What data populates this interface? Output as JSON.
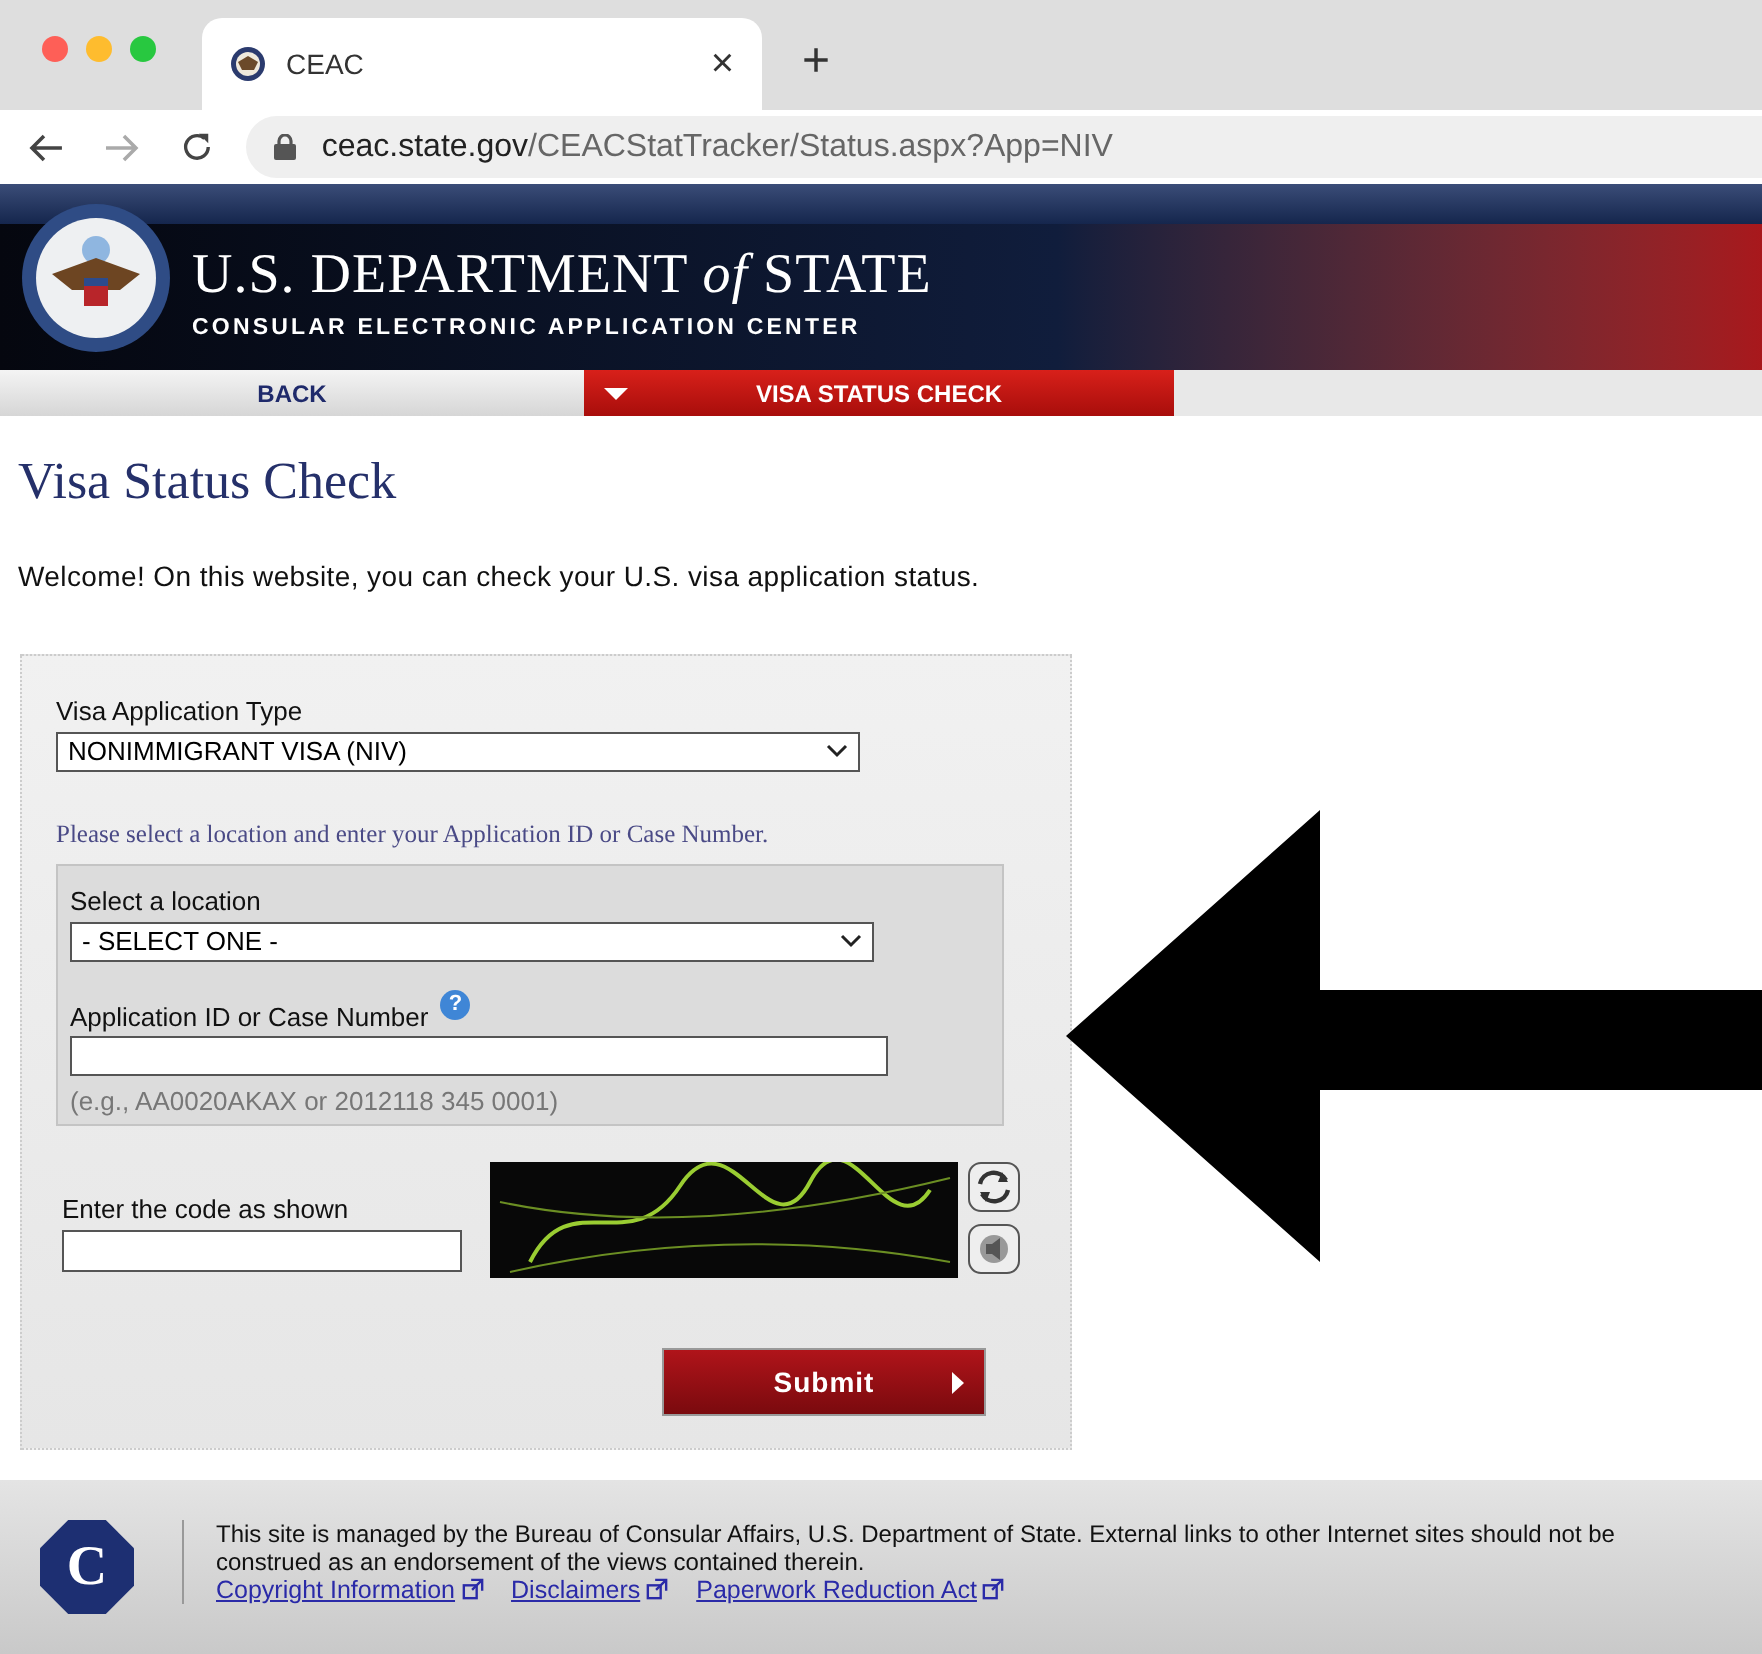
{
  "browser": {
    "tab_title": "CEAC",
    "tab_close": "×",
    "new_tab": "+",
    "url_host": "ceac.state.gov",
    "url_path": "/CEACStatTracker/Status.aspx?App=NIV"
  },
  "banner": {
    "title": "U.S. DEPARTMENT *of* STATE",
    "subtitle": "CONSULAR ELECTRONIC APPLICATION CENTER"
  },
  "nav": [
    {
      "label": "BACK",
      "selected": false
    },
    {
      "label": "VISA STATUS CHECK",
      "selected": true
    }
  ],
  "page_title": "Visa Status Check",
  "welcome": "Welcome! On this website, you can check your U.S. visa application status.",
  "form": {
    "type_label": "Visa Application Type",
    "type_value": "NONIMMIGRANT VISA (NIV)",
    "instruction": "Please select a location and enter your Application ID or Case Number.",
    "location_label": "Select a location",
    "location_value": "- SELECT ONE -",
    "id_label": "Application ID or Case Number",
    "id_hint": "(e.g., AA0020AKAX or 2012118 345 0001)",
    "help_glyph": "?",
    "code_label": "Enter the code as shown",
    "submit": "Submit"
  },
  "footer": {
    "logo_letter": "C",
    "notice": "This site is managed by the Bureau of Consular Affairs, U.S. Department of State. External links to other Internet sites should not be construed as an endorsement of the views contained therein.",
    "links": [
      "Copyright Information",
      "Disclaimers",
      "Paperwork Reduction Act"
    ]
  }
}
